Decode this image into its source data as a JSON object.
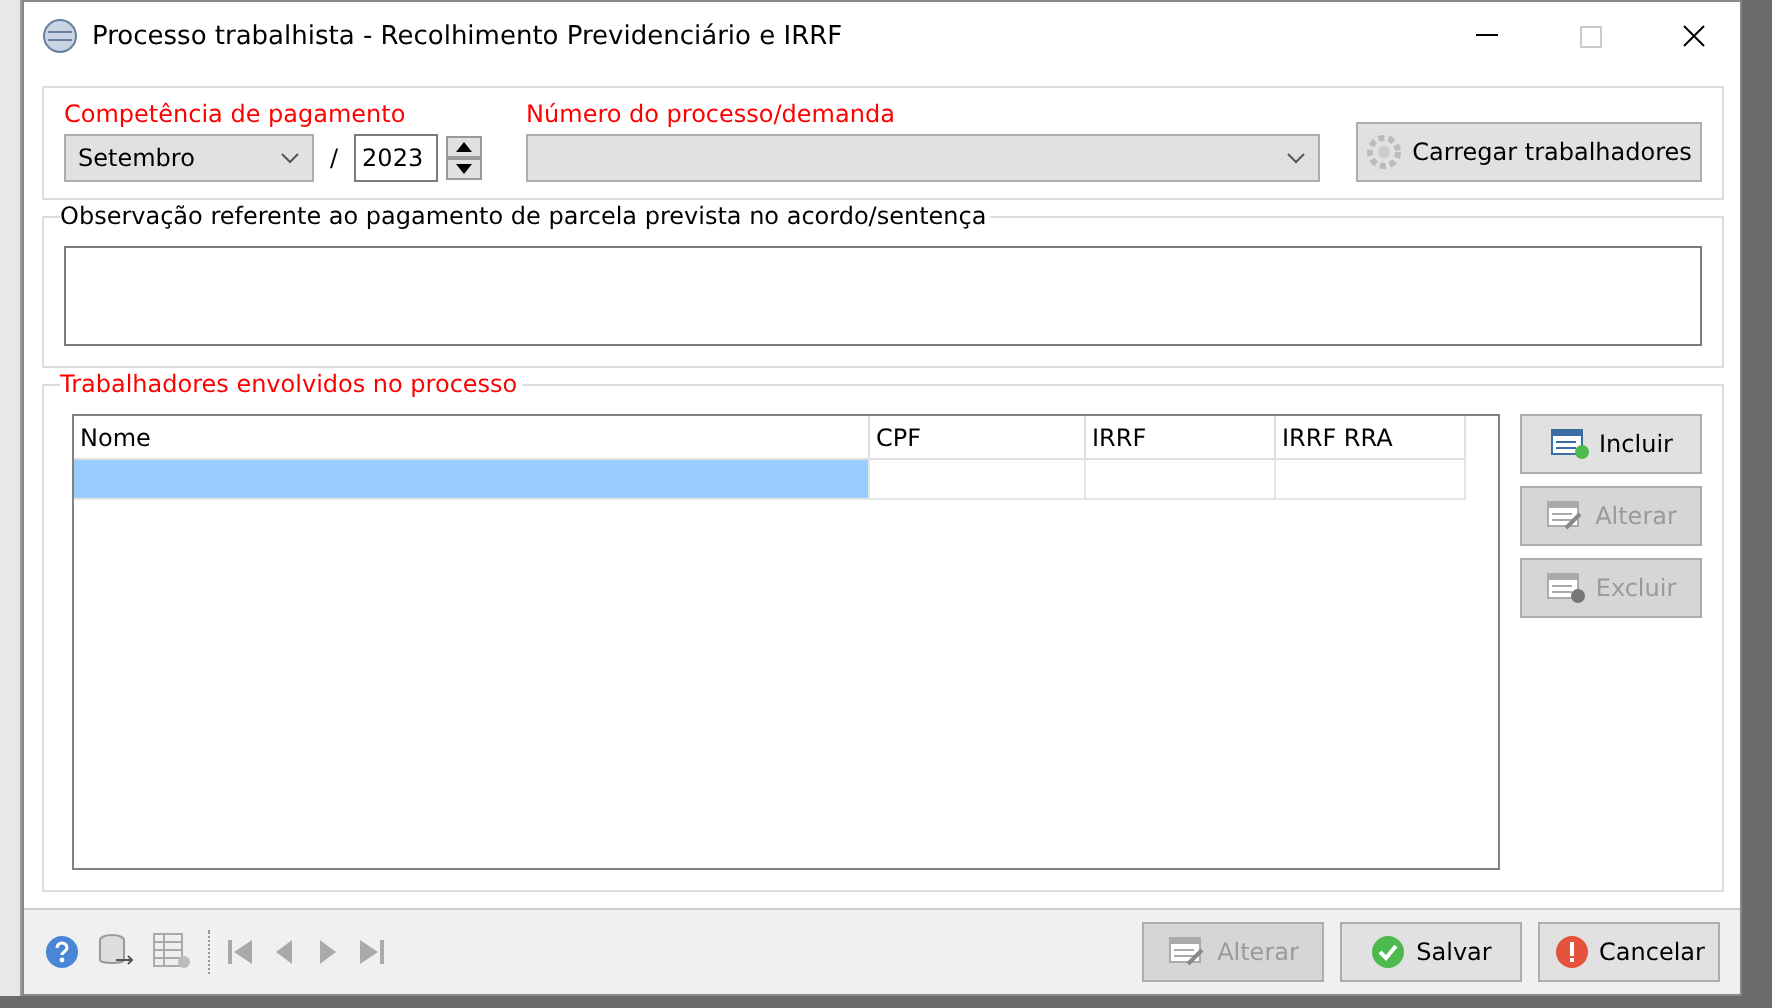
{
  "window": {
    "title": "Processo trabalhista - Recolhimento Previdenciário e IRRF"
  },
  "payment": {
    "label": "Competência de pagamento",
    "month": "Setembro",
    "separator": "/",
    "year": "2023"
  },
  "process": {
    "label": "Número do processo/demanda"
  },
  "load_button": {
    "label": "Carregar trabalhadores"
  },
  "note": {
    "label": "Observação referente ao pagamento de parcela prevista no acordo/sentença"
  },
  "workers": {
    "label": "Trabalhadores envolvidos no processo",
    "columns": [
      "Nome",
      "CPF",
      "IRRF",
      "IRRF RRA"
    ],
    "rows": [
      {
        "selected": true
      }
    ],
    "buttons": [
      {
        "kind": "add",
        "label": "Incluir",
        "disabled": false
      },
      {
        "kind": "edit",
        "label": "Alterar",
        "disabled": true
      },
      {
        "kind": "delete",
        "label": "Excluir",
        "disabled": true
      }
    ]
  },
  "footer": {
    "buttons": [
      {
        "kind": "edit",
        "label": "Alterar",
        "disabled": true
      },
      {
        "kind": "save",
        "label": "Salvar",
        "disabled": false
      },
      {
        "kind": "cancel",
        "label": "Cancelar",
        "disabled": false
      }
    ]
  }
}
